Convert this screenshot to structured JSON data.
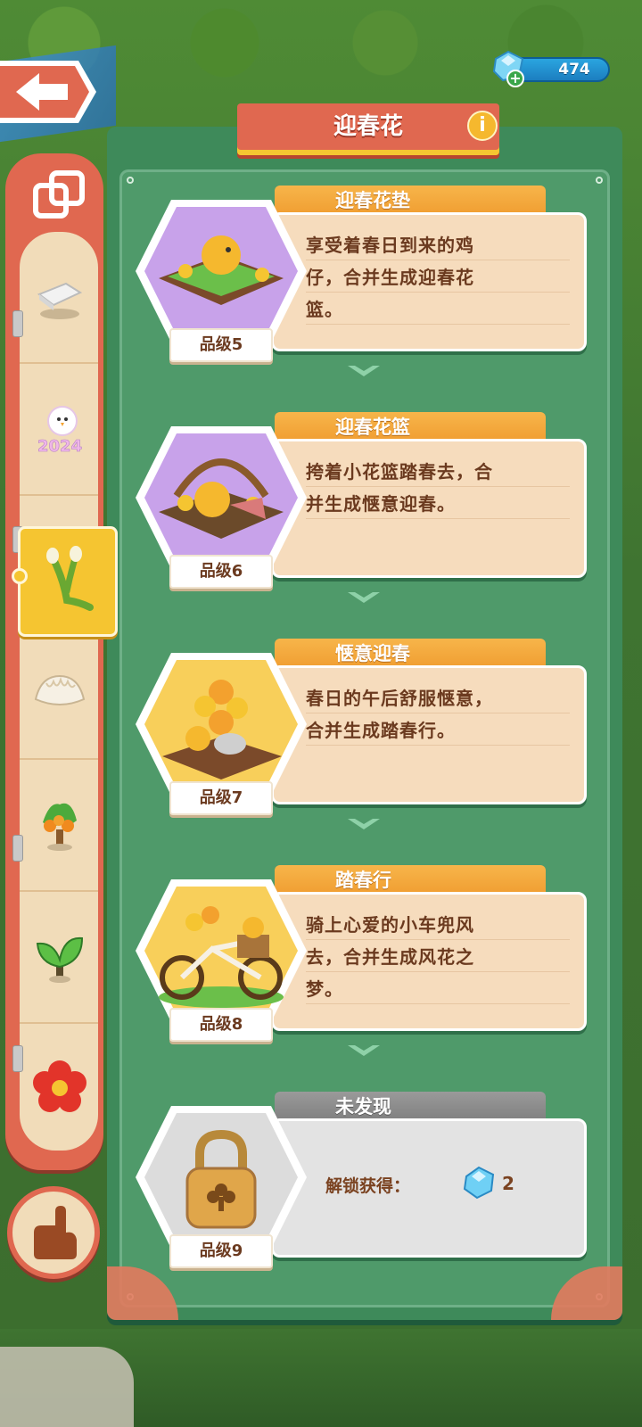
{
  "currency": {
    "gems": "474",
    "icon": "diamond-gem-icon"
  },
  "panel": {
    "title": "迎春花",
    "info_symbol": "i"
  },
  "sidebar": {
    "items": [
      {
        "name": "eraser-category",
        "icon": "eraser-icon"
      },
      {
        "name": "2024-chick-category",
        "icon": "chick-2024-icon"
      },
      {
        "name": "flower-branch-category",
        "icon": "flower-branch-icon",
        "active": true
      },
      {
        "name": "dumpling-category",
        "icon": "dumpling-icon"
      },
      {
        "name": "orange-tree-category",
        "icon": "orange-tree-icon"
      },
      {
        "name": "leaf-plant-category",
        "icon": "leaf-plant-icon"
      },
      {
        "name": "red-flower-category",
        "icon": "red-flower-icon"
      }
    ]
  },
  "cards": [
    {
      "title": "迎春花垫",
      "grade": "品级5",
      "desc": [
        "享受着春日到来的鸡",
        "仔，合并生成迎春花",
        "篮。"
      ],
      "bg": "#c8a2ea"
    },
    {
      "title": "迎春花篮",
      "grade": "品级6",
      "desc": [
        "挎着小花篮踏春去，合",
        "并生成惬意迎春。"
      ],
      "bg": "#c8a2ea"
    },
    {
      "title": "惬意迎春",
      "grade": "品级7",
      "desc": [
        "春日的午后舒服惬意，",
        "合并生成踏春行。"
      ],
      "bg": "#f8cf5a"
    },
    {
      "title": "踏春行",
      "grade": "品级8",
      "desc": [
        "骑上心爱的小车兜风",
        "去，合并生成风花之",
        "梦。"
      ],
      "bg": "#f8cf5a"
    },
    {
      "title": "未发现",
      "grade": "品级9",
      "unlock_label": "解锁获得：",
      "unlock_count": "2",
      "locked": true
    }
  ],
  "colors": {
    "panel_green": "#3e8a5a",
    "title_red": "#e06850",
    "label_orange": "#ef9a2e",
    "card_cream": "#f6dcbd"
  }
}
